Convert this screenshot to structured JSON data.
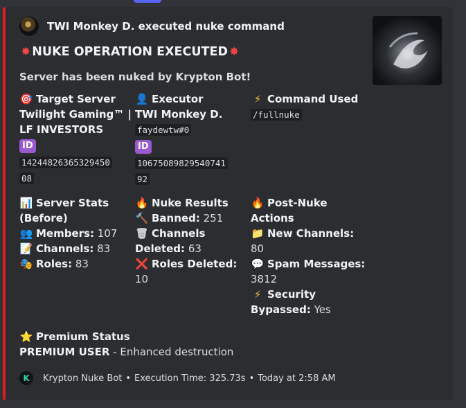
{
  "embed": {
    "accent_color": "#e01e1e",
    "author": {
      "name": "TWI Monkey D. executed nuke command",
      "avatar_icon": "user-avatar"
    },
    "thumbnail_icon": "swirl-logo-image",
    "title": "NUKE OPERATION EXECUTED",
    "title_icon": "sparkle-burst-icon",
    "description": "Server has been nuked by Krypton Bot!",
    "fields": {
      "target": {
        "icon": "🎯",
        "icon_name": "target-icon",
        "name": "Target Server",
        "value_line1": "Twilight Gaming™ |",
        "value_line2": "LF INVESTORS",
        "id_badge": "ID",
        "id_line1": "14244826365329450",
        "id_line2": "08"
      },
      "executor": {
        "icon": "👤",
        "icon_name": "user-icon",
        "name": "Executor",
        "value": "TWI Monkey D.",
        "tag": "faydewtw#0",
        "id_badge": "ID",
        "id_line1": "10675089829540741",
        "id_line2": "92"
      },
      "command": {
        "icon": "⚡",
        "icon_name": "lightning-icon",
        "name": "Command Used",
        "value": "/fullnuke"
      },
      "stats": {
        "icon": "📊",
        "icon_name": "bar-chart-icon",
        "name_line1": "Server Stats",
        "name_line2": "(Before)",
        "members_icon": "👥",
        "members_label": "Members:",
        "members": "107",
        "channels_icon": "📝",
        "channels_label": "Channels:",
        "channels": "83",
        "roles_icon": "🎭",
        "roles_label": "Roles:",
        "roles": "83"
      },
      "results": {
        "icon": "🔥",
        "icon_name": "fire-icon",
        "name": "Nuke Results",
        "banned_icon": "🔨",
        "banned_label": "Banned:",
        "banned": "251",
        "deleted_icon": "🗑",
        "deleted_label1": "Channels",
        "deleted_label2": "Deleted:",
        "deleted": "63",
        "roles_icon": "❌",
        "roles_label": "Roles Deleted:",
        "roles": "10"
      },
      "post": {
        "icon": "🔥",
        "icon_name": "fire-icon",
        "name_line1": "Post-Nuke",
        "name_line2": "Actions",
        "channels_icon": "📁",
        "channels_label": "New Channels:",
        "channels": "80",
        "spam_icon": "💬",
        "spam_label": "Spam Messages:",
        "spam": "3812",
        "security_icon": "⚡",
        "security_label1": "Security",
        "security_label2": "Bypassed:",
        "security": "Yes"
      },
      "premium": {
        "icon": "⭐",
        "icon_name": "star-icon",
        "name": "Premium Status",
        "value_bold": "PREMIUM USER",
        "value_rest": " - Enhanced destruction"
      }
    },
    "footer": {
      "icon_letter": "K",
      "text": "Krypton Nuke Bot",
      "execution": "Execution Time: 325.73s",
      "timestamp": "Today at 2:58 AM"
    }
  }
}
